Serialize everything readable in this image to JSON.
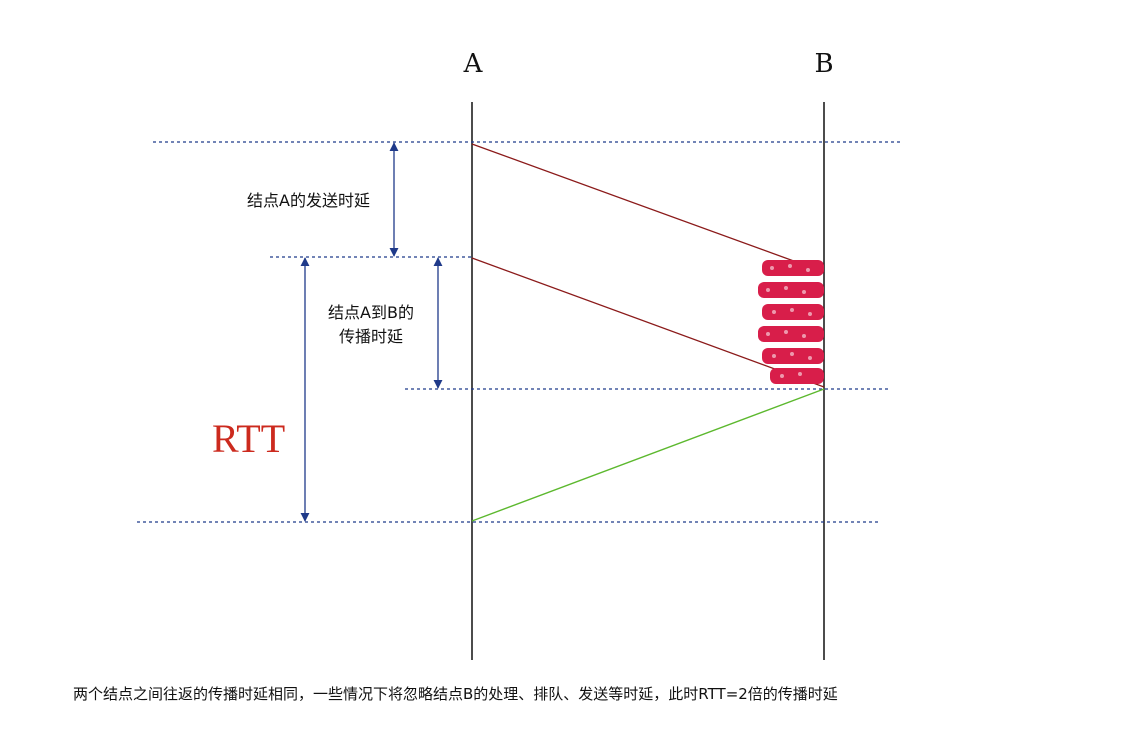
{
  "nodes": {
    "a": "A",
    "b": "B"
  },
  "annotations": {
    "send_delay": "结点A的发送时延",
    "prop_delay_line1": "结点A到B的",
    "prop_delay_line2": "传播时延",
    "rtt": "RTT"
  },
  "caption": "两个结点之间往返的传播时延相同，一些情况下将忽略结点B的处理、排队、发送等时延，此时RTT=2倍的传播时延",
  "colors": {
    "timeline": "#111111",
    "dotted_guide": "#1f3a8a",
    "arrow": "#1f3a8a",
    "send_line": "#8b1a1a",
    "return_line": "#5cb82e",
    "rtt_text": "#cc2a1e",
    "received_bits": "#d81e4a"
  }
}
